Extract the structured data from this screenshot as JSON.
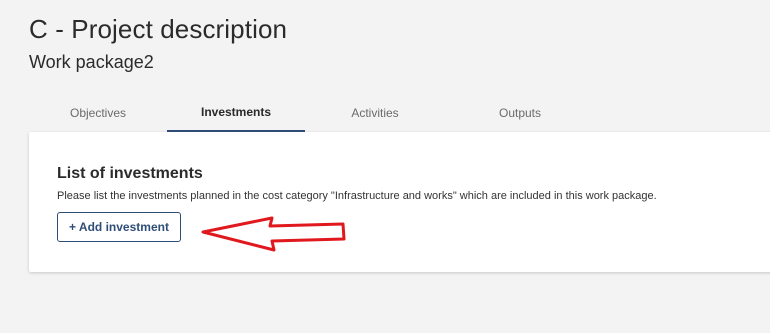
{
  "header": {
    "title": "C - Project description",
    "subtitle": "Work package2"
  },
  "tabs": [
    {
      "label": "Objectives",
      "active": false
    },
    {
      "label": "Investments",
      "active": true
    },
    {
      "label": "Activities",
      "active": false
    },
    {
      "label": "Outputs",
      "active": false
    }
  ],
  "investments": {
    "title": "List of investments",
    "description": "Please list the investments planned in the cost category \"Infrastructure and works\" which are included in this work package.",
    "add_button_label": "+ Add investment"
  },
  "colors": {
    "accent": "#2f4e77",
    "annotation_arrow": "#e0191f",
    "background": "#f3f3f4"
  },
  "icons": {
    "annotation": "red-outline-arrow-icon"
  }
}
